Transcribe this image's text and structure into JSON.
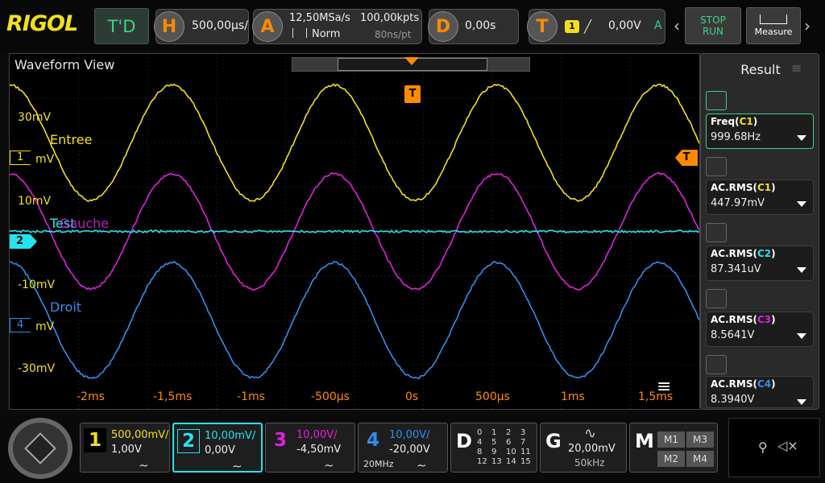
{
  "brand": {
    "logo": "RIGOL"
  },
  "top": {
    "td_label": "T'D",
    "horizontal": {
      "icon_letter": "H",
      "value": "500,00µs/"
    },
    "acquire": {
      "icon_letter": "A",
      "sample_rate": "12,50MSa/s",
      "mode": "Norm",
      "points": "100,00kpts",
      "time_per_point": "80ns/pt"
    },
    "delay": {
      "icon_letter": "D",
      "value": "0,00s"
    },
    "trigger": {
      "icon_letter": "T",
      "source": "1",
      "level": "0,00V",
      "status": "A"
    },
    "stop_run": {
      "stop": "STOP",
      "run": "RUN"
    },
    "measure_label": "Measure"
  },
  "waveform": {
    "title": "Waveform View",
    "trigger_marker": "T",
    "trigger_level_marker": "T",
    "y_labels": [
      {
        "text": "30mV",
        "color": "#f2e01a"
      },
      {
        "text": "mV",
        "color": "#f2e01a"
      },
      {
        "text": "10mV",
        "color": "#f2e01a"
      },
      {
        "text": "-10mV",
        "color": "#f2e01a"
      },
      {
        "text": "mV",
        "color": "#f2e01a"
      },
      {
        "text": "-30mV",
        "color": "#f2e01a"
      }
    ],
    "x_labels": [
      "-2ms",
      "-1,5ms",
      "-1ms",
      "-500µs",
      "0s",
      "500µs",
      "1ms",
      "1,5ms"
    ],
    "channel_markers": [
      {
        "num": "1",
        "color": "#f2e01a"
      },
      {
        "num": "2",
        "color": "#22e4f0"
      },
      {
        "num": "4",
        "color": "#2f8ff0"
      }
    ],
    "labels": [
      {
        "text": "Entree",
        "color": "#f2e01a"
      },
      {
        "text": "Test",
        "color": "#22e4f0"
      },
      {
        "text": "Gauche",
        "color": "#e020e0"
      },
      {
        "text": "Droit",
        "color": "#2f8ff0"
      }
    ]
  },
  "chart_data": {
    "type": "line",
    "x_unit": "ms",
    "xlim": [
      -2.5,
      1.75
    ],
    "series": [
      {
        "name": "Entree",
        "color": "#f2e01a",
        "freq_khz": 1.0,
        "phase_deg": 0,
        "offset_div": 2.0,
        "amp_div": 1.3
      },
      {
        "name": "Gauche",
        "color": "#e020e0",
        "freq_khz": 1.0,
        "phase_deg": 0,
        "offset_div": 0.0,
        "amp_div": 1.3
      },
      {
        "name": "Test",
        "color": "#22e4f0",
        "freq_khz": 1.0,
        "phase_deg": 0,
        "offset_div": 0.0,
        "amp_div": 0.0
      },
      {
        "name": "Droit",
        "color": "#2f8ff0",
        "freq_khz": 1.0,
        "phase_deg": 0,
        "offset_div": -2.0,
        "amp_div": 1.3
      }
    ]
  },
  "result": {
    "title": "Result",
    "items": [
      {
        "name": "Freq",
        "src": "C1",
        "src_color": "#f2e01a",
        "value": "999.68Hz"
      },
      {
        "name": "AC.RMS",
        "src": "C1",
        "src_color": "#f2e01a",
        "value": "447.97mV"
      },
      {
        "name": "AC.RMS",
        "src": "C2",
        "src_color": "#22e4f0",
        "value": "87.341uV"
      },
      {
        "name": "AC.RMS",
        "src": "C3",
        "src_color": "#e020e0",
        "value": "8.5641V"
      },
      {
        "name": "AC.RMS",
        "src": "C4",
        "src_color": "#2f8ff0",
        "value": "8.3940V"
      }
    ]
  },
  "channels": [
    {
      "num": "1",
      "color": "#f2e01a",
      "scale": "500,00mV/",
      "offset": "1,00V",
      "extra": ""
    },
    {
      "num": "2",
      "color": "#22e4f0",
      "scale": "10,00mV/",
      "offset": "0,00V",
      "extra": ""
    },
    {
      "num": "3",
      "color": "#e020e0",
      "scale": "10,00V/",
      "offset": "-4,50mV",
      "extra": ""
    },
    {
      "num": "4",
      "color": "#2f8ff0",
      "scale": "10,00V/",
      "offset": "-20,00V",
      "extra": "20MHz"
    }
  ],
  "digital": {
    "letter": "D",
    "numbers": [
      "0",
      "1",
      "2",
      "3",
      "4",
      "5",
      "6",
      "7",
      "8",
      "9",
      "10",
      "11",
      "12",
      "13",
      "14",
      "15"
    ]
  },
  "generator": {
    "letter": "G",
    "amplitude": "20,00mV",
    "frequency": "50kHz"
  },
  "math": {
    "letter": "M",
    "items": [
      "M1",
      "M3",
      "M2",
      "M4"
    ]
  }
}
